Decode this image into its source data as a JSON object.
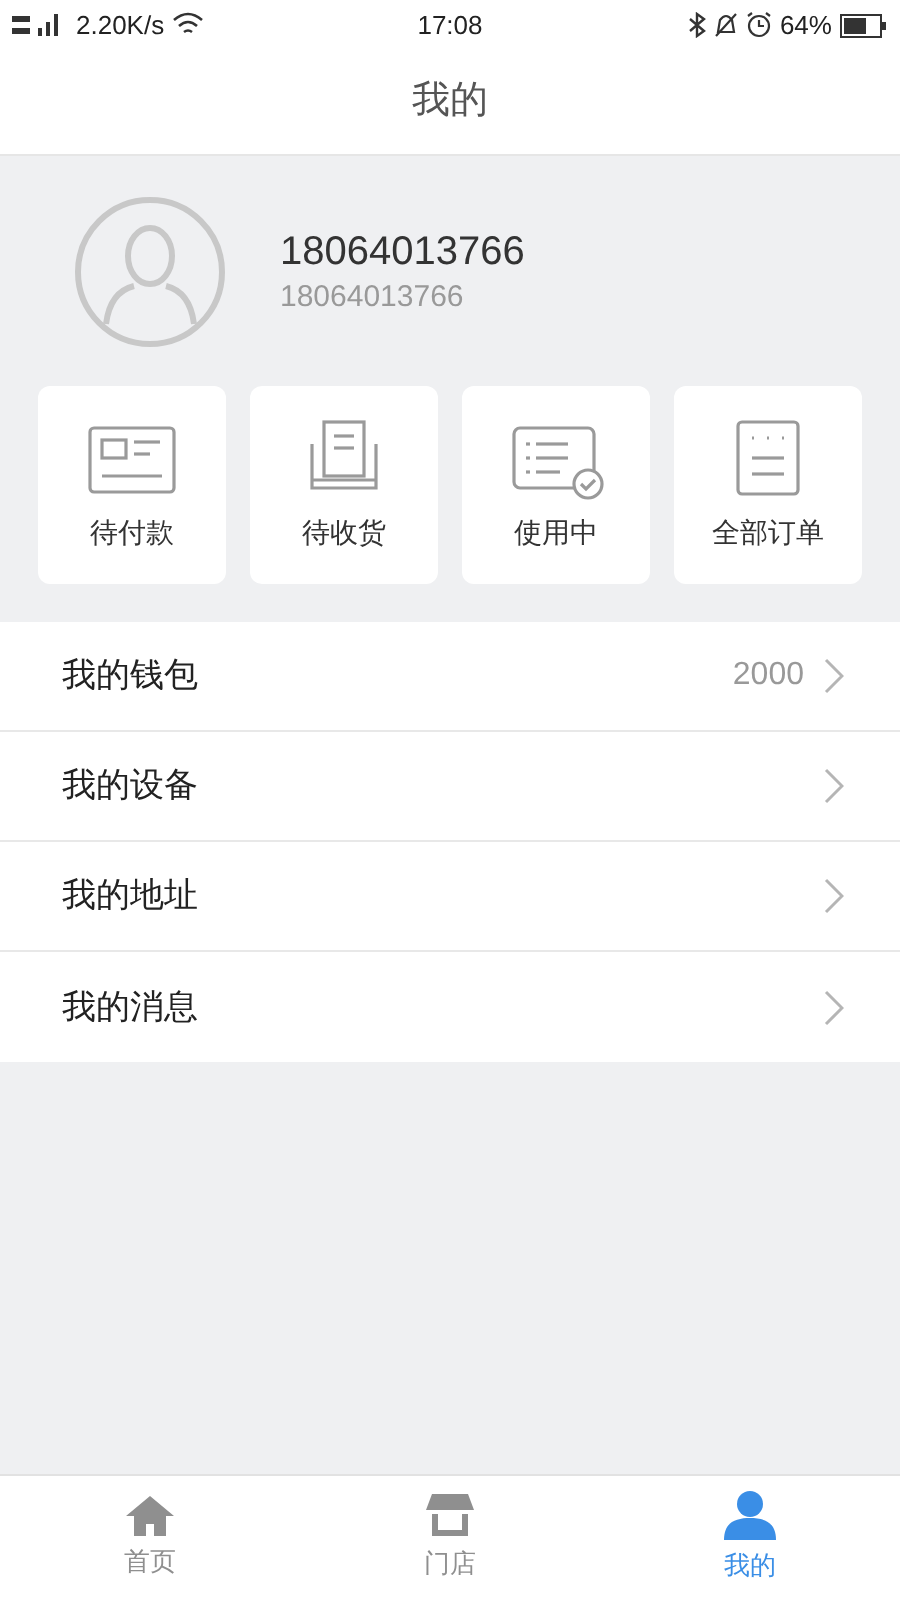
{
  "status_bar": {
    "network": "2.20K/s",
    "time": "17:08",
    "battery": "64%"
  },
  "header": {
    "title": "我的"
  },
  "profile": {
    "phone": "18064013766",
    "subtitle": "18064013766"
  },
  "orders": [
    {
      "kind": "pay",
      "label": "待付款"
    },
    {
      "kind": "receive",
      "label": "待收货"
    },
    {
      "kind": "using",
      "label": "使用中"
    },
    {
      "kind": "all",
      "label": "全部订单"
    }
  ],
  "menu": [
    {
      "label": "我的钱包",
      "value": "2000"
    },
    {
      "label": "我的设备"
    },
    {
      "label": "我的地址"
    },
    {
      "label": "我的消息"
    }
  ],
  "tabs": [
    {
      "kind": "home",
      "label": "首页",
      "selected": false
    },
    {
      "kind": "store",
      "label": "门店",
      "selected": false
    },
    {
      "kind": "me",
      "label": "我的",
      "selected": true
    }
  ]
}
